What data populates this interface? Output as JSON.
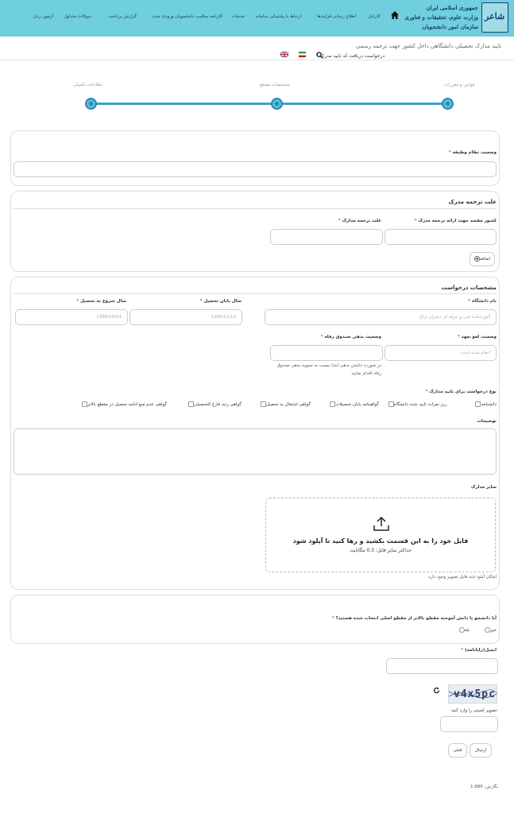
{
  "header": {
    "logo_lines": [
      "جمهوری اسلامی ایران",
      "وزارت علوم، تحقیقات و فناوری",
      "سازمان امور دانشجویان"
    ],
    "logo_mark": "شاعر",
    "nav": [
      "کارتابل",
      "اطلاع رسانی فرایندها",
      "ارتباط با پشتیبانی سامانه",
      "خدمات",
      "کارنامه سلامت دانشجویان ورودی جدید",
      "گزارش پرداخت",
      "سوالات متداول",
      "آزمون زبان"
    ]
  },
  "page": {
    "title": "تایید مدارک تحصیلی دانشگاهی داخل کشور جهت ترجمه رسمی",
    "subtitle": "درخواست دریافت کد تایید مدرک"
  },
  "steps": [
    "قوانین و مقررات",
    "مشخصات مقطع",
    "اطلاعات تکمیلی"
  ],
  "section1": {
    "label": "وضعیت نظام وظیفه"
  },
  "section2": {
    "title": "علت ترجمه مدرک",
    "country_label": "کشور مقصد جهت ارائه ترجمه مدرک",
    "reason_label": "علت ترجمه مدارک",
    "add_button": "اضافه"
  },
  "section3": {
    "title": "مشخصات درخواست",
    "university_label": "نام دانشگاه",
    "university_value": "آموزشکده فنی و حرفه ای دختران اراک",
    "end_year_label": "سال پایان تحصیل",
    "end_year_value": "1399/12/10",
    "start_year_label": "سال شروع به تحصیل",
    "start_year_value": "1398/09/01",
    "commitment_label": "وضعیت لغو تعهد",
    "commitment_value": "انجام شده است",
    "welfare_label": "وضعیت بدهی صندوق رفاه",
    "welfare_note_1": "در صورت داشتن بدهی ابتدا نسبت به تسویه بدهی صندوق",
    "welfare_note_2": "رفاه اقدام نمایید",
    "doc_type_label": "نوع درخواست برای تایید مدارک",
    "doc_types": [
      "دانشنامه",
      "ریز نمرات تایید شده دانشگاه",
      "گواهینامه پایان تحصیلات",
      "گواهی اشتغال به تحصیل",
      "گواهی رتبه فارغ التحصیلی",
      "گواهی عدم منع ادامه تحصیل در مقطع بالاتر"
    ],
    "desc_label": "توضیحات",
    "other_docs_label": "سایر مدارک",
    "upload_main": "فایل خود را به این قسمت بکشید و رها کنید تا آپلود شود",
    "upload_size": "حداکثر سایز فایل: 0.3 مگابایت",
    "upload_note": "امکان آپلود چند فایل تصویر وجود دارد"
  },
  "section4": {
    "question": "آیا دانشجو یا دانش آموخته مقطع بالاتر از مقطع اصلی انتخاب شده هستید؟",
    "yes": "بله",
    "no": "خیر"
  },
  "bottom": {
    "email_label": "ایمیل(رایانامه)",
    "captcha_text": "v4x5pc",
    "captcha_label": "تصویر امنیتی را وارد کنید:",
    "send": "ارسال",
    "prev": "قبلی",
    "version": "نگارش: 1.689"
  },
  "colors": {
    "header_bg": "#6fcfdd",
    "accent": "#3aa2c8",
    "required": "#d9534f"
  }
}
